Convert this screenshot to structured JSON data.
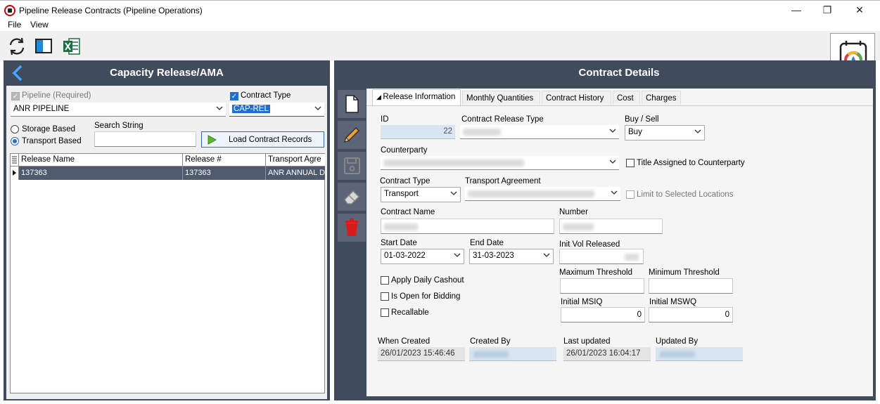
{
  "window": {
    "title": "Pipeline Release Contracts (Pipeline Operations)",
    "minimize": "—",
    "maximize": "❐",
    "close": "✕"
  },
  "menu": {
    "file": "File",
    "view": "View"
  },
  "left": {
    "title": "Capacity Release/AMA",
    "pipeline_label": "Pipeline (Required)",
    "pipeline_value": "ANR PIPELINE",
    "contract_type_label": "Contract Type",
    "contract_type_value": "CAP-REL",
    "storage_based": "Storage Based",
    "transport_based": "Transport Based",
    "search_label": "Search String",
    "search_value": "",
    "load_button": "Load Contract Records",
    "grid": {
      "columns": [
        "Release Name",
        "Release #",
        "Transport Agre"
      ],
      "rows": [
        [
          "137363",
          "137363",
          "ANR ANNUAL D"
        ]
      ]
    }
  },
  "right": {
    "title": "Contract Details",
    "tabs": [
      "Release Information",
      "Monthly Quantities",
      "Contract History",
      "Cost",
      "Charges"
    ],
    "id_label": "ID",
    "id_value": "22",
    "release_type_label": "Contract Release Type",
    "buy_sell_label": "Buy / Sell",
    "buy_sell_value": "Buy",
    "counterparty_label": "Counterparty",
    "title_assigned": "Title Assigned to Counterparty",
    "contract_type_label": "Contract Type",
    "contract_type_value": "Transport",
    "transport_agreement_label": "Transport Agreement",
    "limit_locations": "Limit to Selected Locations",
    "contract_name_label": "Contract Name",
    "number_label": "Number",
    "start_date_label": "Start Date",
    "start_date_value": "01-03-2022",
    "end_date_label": "End Date",
    "end_date_value": "31-03-2023",
    "init_vol_label": "Init Vol Released",
    "max_threshold_label": "Maximum Threshold",
    "min_threshold_label": "Minimum Threshold",
    "apply_daily_cashout": "Apply Daily Cashout",
    "open_for_bidding": "Is Open for Bidding",
    "recallable": "Recallable",
    "initial_msiq_label": "Initial MSIQ",
    "initial_msiq_value": "0",
    "initial_mswq_label": "Initial MSWQ",
    "initial_mswq_value": "0",
    "when_created_label": "When Created",
    "when_created_value": "26/01/2023 15:46:46",
    "created_by_label": "Created By",
    "last_updated_label": "Last updated",
    "last_updated_value": "26/01/2023 16:04:17",
    "updated_by_label": "Updated By"
  },
  "colors": {
    "panel": "#404b5c",
    "accent": "#1f6fd0",
    "selected_row": "#4e5a6e",
    "delete_red": "#d91a1a"
  }
}
